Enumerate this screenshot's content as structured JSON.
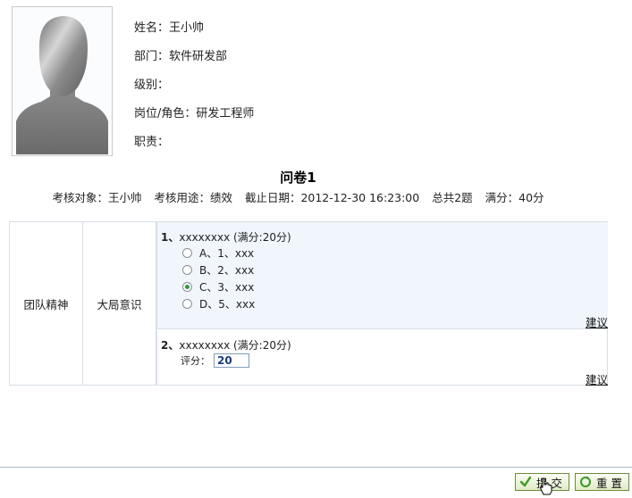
{
  "profile": {
    "name_line": "姓名：王小帅",
    "dept_line": "部门：软件研发部",
    "level_line": "级别：",
    "position_line": "岗位/角色：研发工程师",
    "duty_line": "职责："
  },
  "survey": {
    "title": "问卷1",
    "target": "考核对象：王小帅",
    "purpose": "考核用途：绩效",
    "deadline": "截止日期：2012-12-30 16:23:00",
    "total": "总共2题",
    "full_score": "满分：40分"
  },
  "table": {
    "category": "团队精神",
    "subcategory": "大局意识",
    "q1": {
      "number": "1、",
      "text": "xxxxxxxx (满分:20分)",
      "options": [
        {
          "label": "A、1、xxx",
          "checked": false
        },
        {
          "label": "B、2、xxx",
          "checked": false
        },
        {
          "label": "C、3、xxx",
          "checked": true
        },
        {
          "label": "D、5、xxx",
          "checked": false
        }
      ],
      "suggest": "建议"
    },
    "q2": {
      "number": "2、",
      "text": "xxxxxxxx (满分:20分)",
      "score_label": "评分：",
      "score_value": "20",
      "suggest": "建议"
    }
  },
  "footer": {
    "submit_label": "提 交",
    "reset_label": "重 置"
  }
}
